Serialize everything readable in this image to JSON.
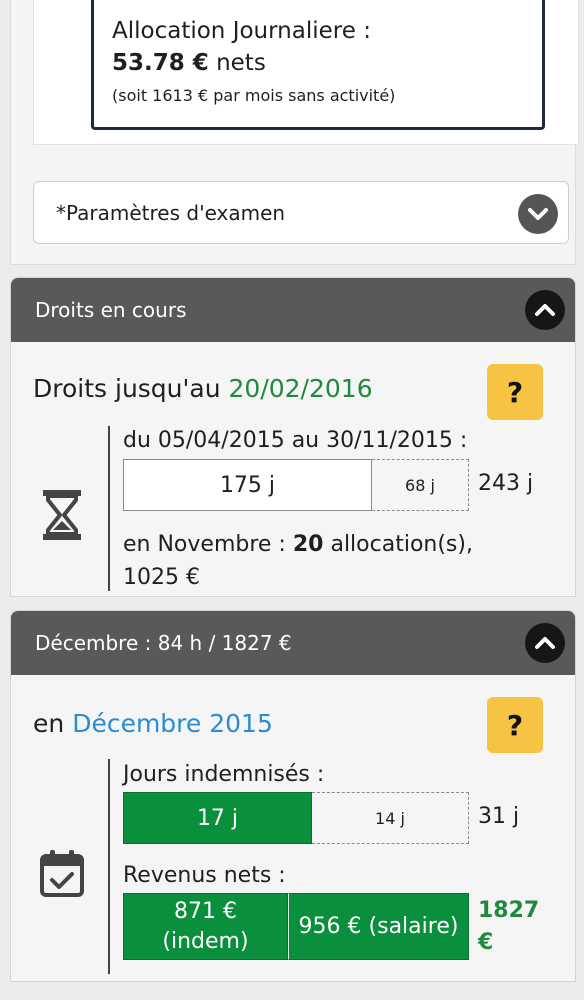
{
  "allocation": {
    "title": "Allocation Journaliere :",
    "amount": "53.78 €",
    "amount_suffix": " nets",
    "note": "(soit 1613 € par mois sans activité)"
  },
  "params": {
    "label": "*Paramètres d'examen"
  },
  "droits": {
    "header": "Droits en cours",
    "title_prefix": "Droits jusqu'au ",
    "title_date": "20/02/2016",
    "help": "?",
    "period": "du 05/04/2015 au 30/11/2015 :",
    "used": "175 j",
    "remaining": "68 j",
    "total": "243 j",
    "month_prefix": "en Novembre : ",
    "month_count": "20",
    "month_suffix": " allocation(s),",
    "month_amount": "1025 €"
  },
  "decembre": {
    "header": "Décembre : 84 h / 1827 €",
    "title_prefix": "en ",
    "title_month": "Décembre 2015",
    "help": "?",
    "days_label": "Jours indemnisés :",
    "days_paid": "17 j",
    "days_other": "14 j",
    "days_total": "31 j",
    "income_label": "Revenus nets :",
    "income_indem_line1": "871 €",
    "income_indem_line2": "(indem)",
    "income_salary": "956 € (salaire)",
    "income_total_line1": "1827",
    "income_total_line2": "€"
  },
  "icons": {
    "params_toggle": "chevron-down-icon",
    "section_toggle": "chevron-up-icon",
    "droits_icon": "hourglass-icon",
    "decembre_icon": "calendar-check-icon"
  },
  "colors": {
    "header_bg": "#595959",
    "help_bg": "#f6c342",
    "green": "#0a8f3c",
    "date_green": "#1f8a3e",
    "month_blue": "#2b8ccf",
    "alloc_border": "#1e2b3d"
  }
}
